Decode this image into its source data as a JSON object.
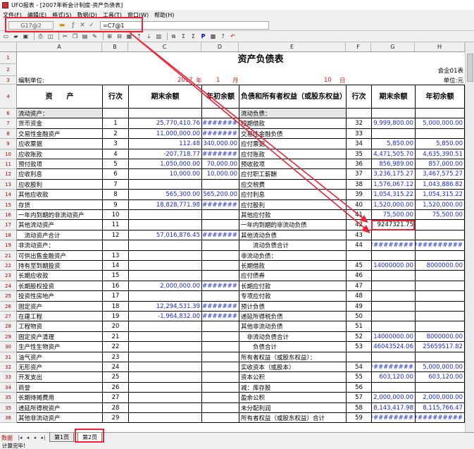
{
  "window": {
    "title": "UFO报表 - [2007年新会计制度-资产负债表]"
  },
  "menu": [
    "文件(F)",
    "编辑(E)",
    "格式(S)",
    "数据(D)",
    "工具(T)",
    "窗口(W)",
    "帮助(H)"
  ],
  "editbar": {
    "cell_ref": "G17@2",
    "formula": "=C7@1"
  },
  "toolbar_icons": [
    "new-icon",
    "open-icon",
    "save-icon",
    "print-icon",
    "preview-icon",
    "cut-icon",
    "copy-icon",
    "paste-icon",
    "format-painter-icon",
    "insert-row-icon",
    "delete-row-icon",
    "table-icon",
    "sort-asc-icon",
    "sort-desc-icon",
    "chart-icon",
    "merge-icon",
    "sum-icon",
    "font-bold-icon",
    "function-icon",
    "image-icon",
    "help-icon",
    "undo-icon"
  ],
  "columns": [
    "A",
    "B",
    "C",
    "D",
    "E",
    "F",
    "G",
    "H"
  ],
  "sheet": {
    "title": "资产负债表",
    "form_no": "会企01表",
    "unit_label": "编制单位:",
    "unit_right": "单位:元",
    "year_value": "2017",
    "year": "年",
    "month_value": "1",
    "month": "月",
    "day_value": "10",
    "day": "日",
    "header": {
      "asset": "资　　产",
      "seq": "行次",
      "end": "期末余额",
      "begin": "年初余额",
      "liab": "负债和所有者权益（或股东权益）",
      "seq2": "行次",
      "end2": "期末余额",
      "begin2": "年初余额"
    },
    "rows": [
      {
        "no": "6",
        "a": "流动资产：",
        "b": "",
        "c": "",
        "d": "",
        "e": "流动负债：",
        "f": "",
        "g": "",
        "h": ""
      },
      {
        "no": "7",
        "a": "货币资金",
        "b": "1",
        "c": "25,770,410.76",
        "d": "##########",
        "e": "短期借款",
        "f": "32",
        "g": "9,999,800.00",
        "h": "5,000,000.00"
      },
      {
        "no": "8",
        "a": "交易性金融资产",
        "b": "2",
        "c": "11,000,000.00",
        "d": "##########",
        "e": "交易性金融负债",
        "f": "33",
        "g": "",
        "h": ""
      },
      {
        "no": "9",
        "a": "应收票据",
        "b": "3",
        "c": "112.48",
        "d": "340,000.00",
        "e": "应付票据",
        "f": "34",
        "g": "5,850.00",
        "h": "5,850.00"
      },
      {
        "no": "10",
        "a": "应收账款",
        "b": "4",
        "c": "-207,718.77",
        "d": "##########",
        "e": "应付账款",
        "f": "35",
        "g": "4,471,505.70",
        "h": "4,635,390.51"
      },
      {
        "no": "11",
        "a": "预付款项",
        "b": "5",
        "c": "1,050,000.00",
        "d": "70,000.00",
        "e": "预收款项",
        "f": "36",
        "g": "856,989.00",
        "h": "857,000.00"
      },
      {
        "no": "12",
        "a": "应收利息",
        "b": "6",
        "c": "10,000.00",
        "d": "10,000.00",
        "e": "应付职工薪酬",
        "f": "37",
        "g": "3,236,175.27",
        "h": "3,467,575.27"
      },
      {
        "no": "13",
        "a": "应收股利",
        "b": "7",
        "c": "",
        "d": "",
        "e": "应交税费",
        "f": "38",
        "g": "1,576,067.12",
        "h": "1,043,886.82"
      },
      {
        "no": "14",
        "a": "其他应收款",
        "b": "8",
        "c": "565,300.00",
        "d": "565,200.00",
        "e": "应付利息",
        "f": "39",
        "g": "1,054,315.22",
        "h": "1,054,315.22"
      },
      {
        "no": "15",
        "a": "存货",
        "b": "9",
        "c": "18,828,771.98",
        "d": "##########",
        "e": "应付股利",
        "f": "40",
        "g": "1,520,000.00",
        "h": "1,520,000.00"
      },
      {
        "no": "16",
        "a": "一年内到期的非流动资产",
        "b": "10",
        "c": "",
        "d": "",
        "e": "其他应付款",
        "f": "41",
        "g": "75,500.00",
        "h": "75,500.00"
      },
      {
        "no": "17",
        "a": "其他流动资产",
        "b": "11",
        "c": "",
        "d": "",
        "e": "一年内到期的非流动负债",
        "f": "42",
        "g": "9247321.75",
        "h": ""
      },
      {
        "no": "18",
        "a": "　流动资产合计",
        "b": "12",
        "c": "57,016,876.45",
        "d": "##########",
        "e": "其他流动负债",
        "f": "43",
        "g": "",
        "h": ""
      },
      {
        "no": "19",
        "a": "非流动资产：",
        "b": "",
        "c": "",
        "d": "",
        "e": "　　流动负债合计",
        "f": "44",
        "g": "##########",
        "h": "##########"
      },
      {
        "no": "21",
        "a": "可供出售金融资产",
        "b": "13",
        "c": "",
        "d": "",
        "e": "非流动负债：",
        "f": "",
        "g": "",
        "h": ""
      },
      {
        "no": "22",
        "a": "持有至到期投资",
        "b": "14",
        "c": "",
        "d": "",
        "e": "长期借款",
        "f": "45",
        "g": "14000000.00",
        "h": "8000000.00"
      },
      {
        "no": "23",
        "a": "长期应收款",
        "b": "15",
        "c": "",
        "d": "",
        "e": "应付债券",
        "f": "46",
        "g": "",
        "h": ""
      },
      {
        "no": "24",
        "a": "长期股权投资",
        "b": "16",
        "c": "2,000,000.00",
        "d": "##########",
        "e": "长期应付款",
        "f": "47",
        "g": "",
        "h": ""
      },
      {
        "no": "25",
        "a": "投资性房地产",
        "b": "17",
        "c": "",
        "d": "",
        "e": "专项应付款",
        "f": "48",
        "g": "",
        "h": ""
      },
      {
        "no": "26",
        "a": "固定资产",
        "b": "18",
        "c": "12,294,531.39",
        "d": "##########",
        "e": "预计负债",
        "f": "49",
        "g": "",
        "h": ""
      },
      {
        "no": "27",
        "a": "在建工程",
        "b": "19",
        "c": "-1,964,832.00",
        "d": "##########",
        "e": "递延所得税负债",
        "f": "50",
        "g": "",
        "h": ""
      },
      {
        "no": "28",
        "a": "工程物资",
        "b": "20",
        "c": "",
        "d": "",
        "e": "其他非流动负债",
        "f": "51",
        "g": "",
        "h": ""
      },
      {
        "no": "29",
        "a": "固定资产清理",
        "b": "21",
        "c": "",
        "d": "",
        "e": "　非流动负债合计",
        "f": "52",
        "g": "14000000.00",
        "h": "8000000.00"
      },
      {
        "no": "30",
        "a": "生产性生物资产",
        "b": "22",
        "c": "",
        "d": "",
        "e": "　　负债合计",
        "f": "53",
        "g": "46043524.06",
        "h": "25659517.82"
      },
      {
        "no": "31",
        "a": "油气资产",
        "b": "23",
        "c": "",
        "d": "",
        "e": "所有者权益（或股东权益）：",
        "f": "",
        "g": "",
        "h": ""
      },
      {
        "no": "32",
        "a": "无形资产",
        "b": "24",
        "c": "",
        "d": "",
        "e": "实收资本（或股本）",
        "f": "54",
        "g": "##########",
        "h": "5,000,000.00"
      },
      {
        "no": "33",
        "a": "开发支出",
        "b": "25",
        "c": "",
        "d": "",
        "e": "资本公积",
        "f": "55",
        "g": "603,120.00",
        "h": "603,120.00"
      },
      {
        "no": "34",
        "a": "商誉",
        "b": "26",
        "c": "",
        "d": "",
        "e": "减：库存股",
        "f": "56",
        "g": "",
        "h": ""
      },
      {
        "no": "35",
        "a": "长期待摊费用",
        "b": "27",
        "c": "",
        "d": "",
        "e": "盈余公积",
        "f": "57",
        "g": "2,000,000.00",
        "h": "2,000,000.00"
      },
      {
        "no": "35",
        "a": "递延所得税资产",
        "b": "28",
        "c": "",
        "d": "",
        "e": "未分配利润",
        "f": "58",
        "g": "8,143,417.98",
        "h": "8,115,766.47"
      },
      {
        "no": "36",
        "a": "其他非流动资产",
        "b": "29",
        "c": "",
        "d": "",
        "e": "所有者权益（或股东权益）合计",
        "f": "59",
        "g": "##########",
        "h": "##########"
      }
    ]
  },
  "sheettabs": {
    "mode_label": "数据",
    "tabs": [
      "第1页",
      "第2页"
    ],
    "active": "第2页"
  },
  "status": "计算完毕!"
}
